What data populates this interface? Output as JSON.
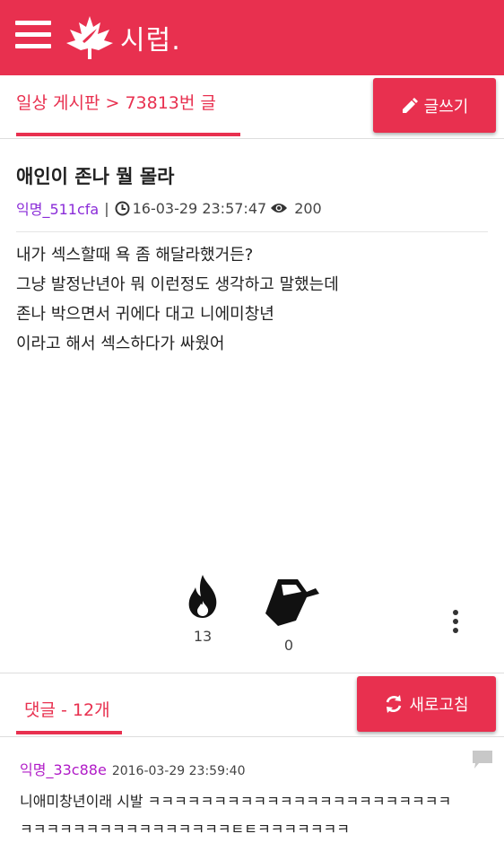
{
  "header": {
    "logo_text": "시럽.",
    "colors": {
      "brand": "#e8304f"
    }
  },
  "board": {
    "breadcrumb": "일상 게시판 > 73813번 글",
    "write_label": "글쓰기"
  },
  "post": {
    "title": "애인이 존나 뭘 몰라",
    "author": "익명_511cfa",
    "timestamp": "16-03-29 23:57:47",
    "views": "200",
    "lines": [
      "내가 섹스할때 욕 좀 해달라했거든?",
      "그냥 발정난년아 뭐 이런정도 생각하고 말했는데",
      "존나 박으면서 귀에다 대고 니에미창년",
      "이라고 해서 섹스하다가 싸웠어"
    ],
    "reactions": {
      "fire_count": "13",
      "bucket_count": "0"
    }
  },
  "comments": {
    "header": "댓글 - 12개",
    "refresh_label": "새로고침",
    "items": [
      {
        "author": "익명_33c88e",
        "date": "2016-03-29 23:59:40",
        "lines": [
          "니애미창년이래 시발 ㅋㅋㅋㅋㅋㅋㅋㅋㅋㅋㅋㅋㅋㅋㅋㅋㅋㅋㅋㅋㅋㅋㅋ",
          "ㅋㅋㅋㅋㅋㅋㅋㅋㅋㅋㅋㅋㅋㅋㅋㅋㅌㅌㅋㅋㅋㅋㅋㅋㅋ"
        ]
      }
    ]
  }
}
